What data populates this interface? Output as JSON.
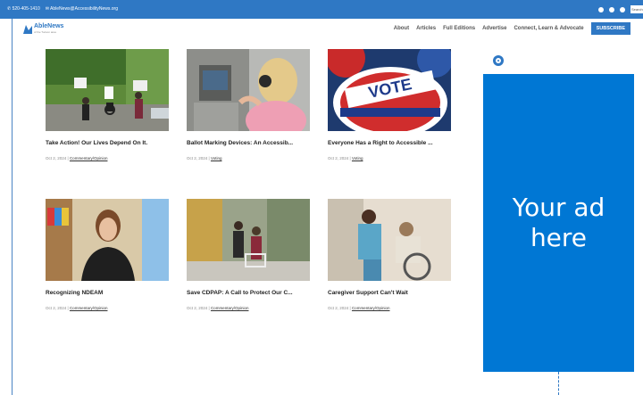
{
  "topbar": {
    "phone": "520-405-1410",
    "email": "AbleNews@AccessibilityNews.org",
    "search_placeholder": "Search"
  },
  "header": {
    "logo_name": "AbleNews",
    "logo_tagline": "of the Tucson area",
    "nav": [
      "About",
      "Articles",
      "Full Editions",
      "Advertise",
      "Connect, Learn & Advocate"
    ],
    "subscribe": "SUBSCRIBE"
  },
  "articles": [
    {
      "title": "Take Action! Our Lives Depend On It.",
      "date": "Oct 2, 2024",
      "category": "Commentary/Opinion",
      "image": "protest-photo"
    },
    {
      "title": "Ballot Marking Devices: An Accessib...",
      "date": "Oct 2, 2024",
      "category": "Voting",
      "image": "voting-machine-photo"
    },
    {
      "title": "Everyone Has a Right to Accessible ...",
      "date": "Oct 2, 2024",
      "category": "Voting",
      "image": "vote-button-photo"
    },
    {
      "title": "Recognizing NDEAM",
      "date": "Oct 2, 2024",
      "category": "Commentary/Opinion",
      "image": "woman-portrait-photo"
    },
    {
      "title": "Save CDPAP: A Call to Protect Our C...",
      "date": "Oct 2, 2024",
      "category": "Commentary/Opinion",
      "image": "walker-street-photo"
    },
    {
      "title": "Caregiver Support Can't Wait",
      "date": "Oct 2, 2024",
      "category": "Commentary/Opinion",
      "image": "caregiver-photo"
    }
  ],
  "ad": {
    "line1": "Your ad",
    "line2": "here"
  },
  "colors": {
    "brand": "#2f78c4",
    "ad_bg": "#0077d4"
  }
}
